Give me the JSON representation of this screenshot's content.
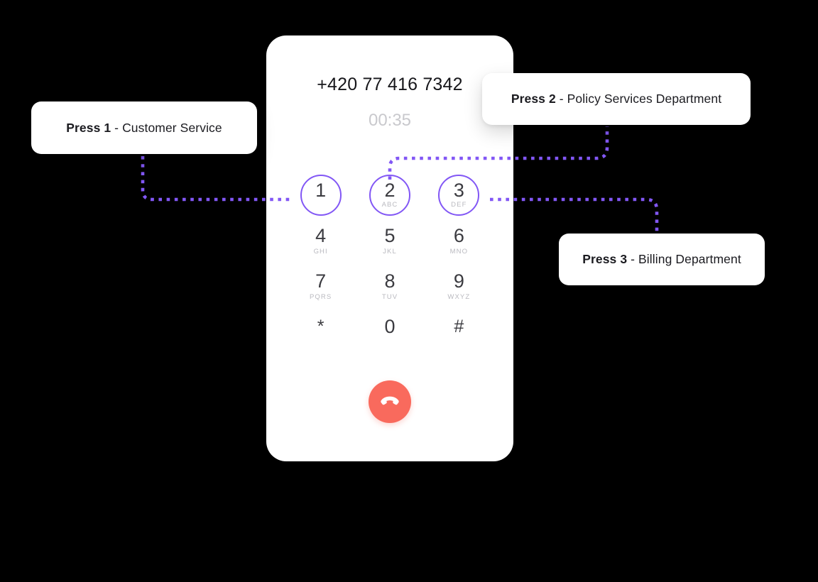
{
  "call": {
    "phone_number": "+420 77 416 7342",
    "timer": "00:35"
  },
  "keypad": {
    "keys": [
      {
        "digit": "1",
        "letters": "",
        "highlighted": true
      },
      {
        "digit": "2",
        "letters": "ABC",
        "highlighted": true
      },
      {
        "digit": "3",
        "letters": "DEF",
        "highlighted": true
      },
      {
        "digit": "4",
        "letters": "GHI",
        "highlighted": false
      },
      {
        "digit": "5",
        "letters": "JKL",
        "highlighted": false
      },
      {
        "digit": "6",
        "letters": "MNO",
        "highlighted": false
      },
      {
        "digit": "7",
        "letters": "PQRS",
        "highlighted": false
      },
      {
        "digit": "8",
        "letters": "TUV",
        "highlighted": false
      },
      {
        "digit": "9",
        "letters": "WXYZ",
        "highlighted": false
      },
      {
        "digit": "*",
        "letters": "",
        "highlighted": false
      },
      {
        "digit": "0",
        "letters": "",
        "highlighted": false
      },
      {
        "digit": "#",
        "letters": "",
        "highlighted": false
      }
    ],
    "highlight_color": "#8257f5"
  },
  "end_call": {
    "icon": "phone-hangup-icon",
    "color": "#f96a5d"
  },
  "callouts": [
    {
      "press": "Press 1",
      "department": " - Customer Service"
    },
    {
      "press": "Press 2",
      "department": " - Policy Services Department"
    },
    {
      "press": "Press 3",
      "department": " - Billing Department"
    }
  ],
  "connectors": {
    "color": "#8257f5",
    "style": "dotted"
  }
}
